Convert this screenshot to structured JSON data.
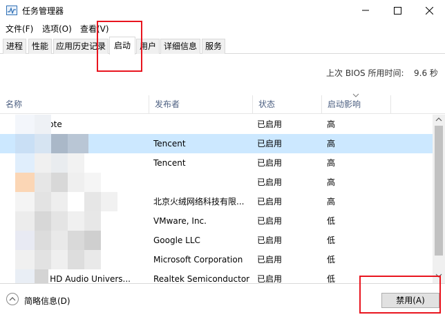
{
  "window": {
    "title": "任务管理器",
    "minimize_icon": "minimize-icon",
    "maximize_icon": "maximize-icon",
    "close_icon": "close-icon"
  },
  "menu": {
    "items": [
      "文件(F)",
      "选项(O)",
      "查看(V)"
    ]
  },
  "tabs": [
    "进程",
    "性能",
    "应用历史记录",
    "启动",
    "用户",
    "详细信息",
    "服务"
  ],
  "active_tab": "启动",
  "bios": {
    "label": "上次 BIOS 所用时间:",
    "value": "9.6 秒"
  },
  "table": {
    "columns": [
      "名称",
      "发布者",
      "状态",
      "启动影响"
    ],
    "rows": [
      {
        "name": "YNote",
        "publisher": "",
        "status": "已启用",
        "impact": "高",
        "selected": false
      },
      {
        "name": "",
        "publisher": "Tencent",
        "status": "已启用",
        "impact": "高",
        "selected": true
      },
      {
        "name": "",
        "publisher": "Tencent",
        "status": "已启用",
        "impact": "高",
        "selected": false
      },
      {
        "name": "",
        "publisher": "",
        "status": "已启用",
        "impact": "高",
        "selected": false
      },
      {
        "name": "",
        "publisher": "北京火绒网络科技有限...",
        "status": "已启用",
        "impact": "高",
        "selected": false
      },
      {
        "name": "",
        "publisher": "VMware, Inc.",
        "status": "已启用",
        "impact": "低",
        "selected": false
      },
      {
        "name": "",
        "publisher": "Google LLC",
        "status": "已启用",
        "impact": "低",
        "selected": false
      },
      {
        "name": "",
        "publisher": "Microsoft Corporation",
        "status": "已启用",
        "impact": "低",
        "selected": false
      },
      {
        "name": "ek HD Audio Univers...",
        "publisher": "Realtek Semiconductor",
        "status": "已启用",
        "impact": "低",
        "selected": false
      }
    ]
  },
  "footer": {
    "fewer_details": "简略信息(D)",
    "disable_button": "禁用(A)"
  },
  "colors": {
    "selection": "#cce8ff",
    "header_text": "#4d6082",
    "annotation": "#e8141e"
  }
}
